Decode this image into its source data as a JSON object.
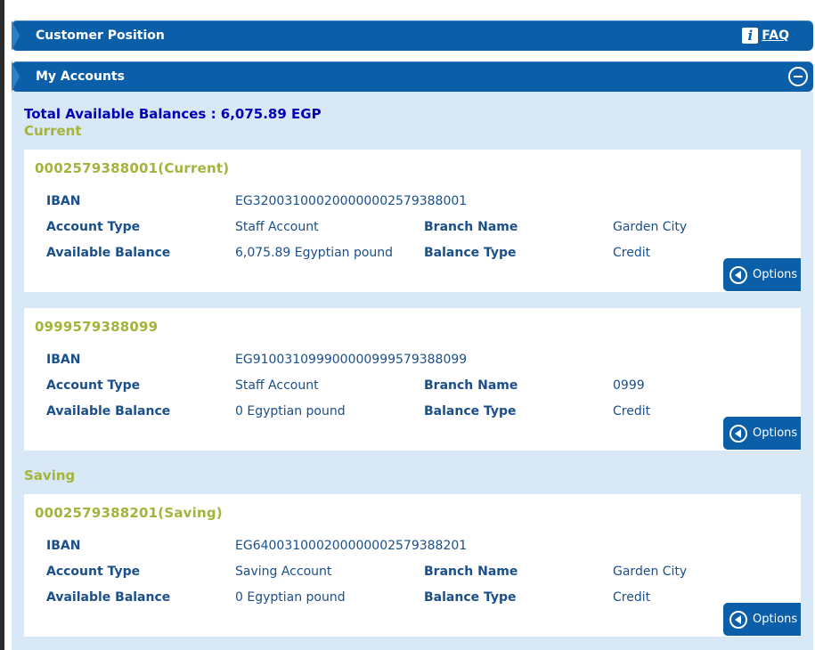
{
  "header": {
    "title": "Customer Position",
    "faq_label": "FAQ"
  },
  "accounts_section": {
    "title": "My Accounts",
    "total_label": "Total Available Balances : 6,075.89 EGP",
    "groups": [
      {
        "name": "Current",
        "accounts": [
          {
            "title": "0002579388001(Current)",
            "iban_label": "IBAN",
            "iban": "EG320031000200000002579388001",
            "account_type_label": "Account Type",
            "account_type": "Staff Account",
            "branch_label": "Branch Name",
            "branch": "Garden City",
            "balance_label": "Available Balance",
            "balance": "6,075.89  Egyptian pound",
            "balance_type_label": "Balance Type",
            "balance_type": "Credit",
            "options_label": "Options"
          },
          {
            "title": "0999579388099",
            "iban_label": "IBAN",
            "iban": "EG910031099900000999579388099",
            "account_type_label": "Account Type",
            "account_type": "Staff Account",
            "branch_label": "Branch Name",
            "branch": "0999",
            "balance_label": "Available Balance",
            "balance": "0  Egyptian pound",
            "balance_type_label": "Balance Type",
            "balance_type": "Credit",
            "options_label": "Options"
          }
        ]
      },
      {
        "name": "Saving",
        "accounts": [
          {
            "title": "0002579388201(Saving)",
            "iban_label": "IBAN",
            "iban": "EG640031000200000002579388201",
            "account_type_label": "Account Type",
            "account_type": "Saving Account",
            "branch_label": "Branch Name",
            "branch": "Garden City",
            "balance_label": "Available Balance",
            "balance": "0  Egyptian pound",
            "balance_type_label": "Balance Type",
            "balance_type": "Credit",
            "options_label": "Options"
          }
        ]
      }
    ]
  },
  "colors": {
    "header_blue": "#0a5fa8",
    "panel_bg": "#d9e8f6",
    "olive": "#a4b43a",
    "text_blue": "#1a4f8a",
    "total_blue": "#0000b8"
  }
}
